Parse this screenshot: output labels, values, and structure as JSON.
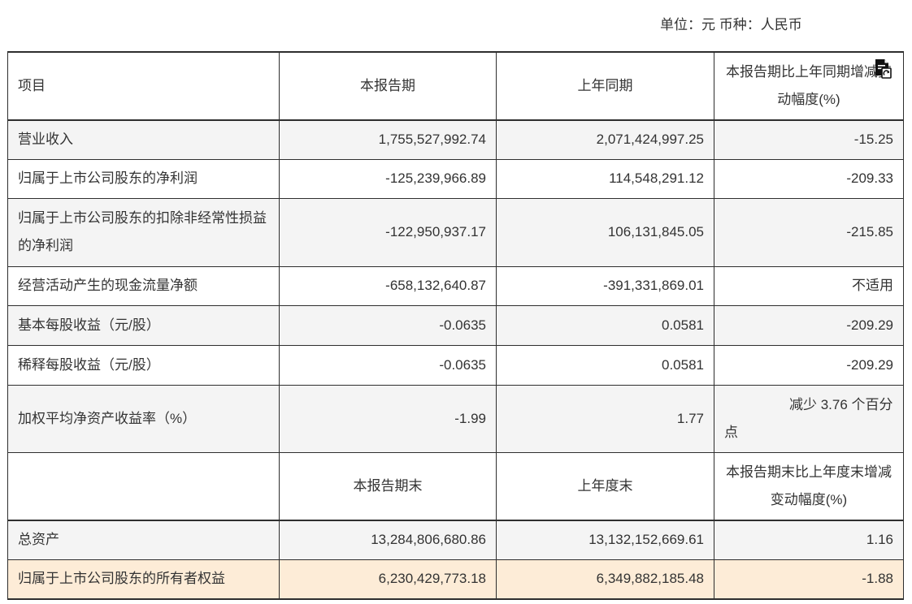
{
  "unit_note": "单位：元 币种：人民币",
  "icons": {
    "export": "document-export-icon"
  },
  "colors": {
    "row_alt": "#f4f4f4",
    "row_highlight": "#fdecd7",
    "border": "#2e2e2e",
    "text": "#333333"
  },
  "table": {
    "header": {
      "item": "项目",
      "current": "本报告期",
      "prior": "上年同期",
      "change": "本报告期比上年同期增减变动幅度(%)"
    },
    "rows": [
      {
        "item": "营业收入",
        "current": "1,755,527,992.74",
        "prior": "2,071,424,997.25",
        "change": "-15.25"
      },
      {
        "item": "归属于上市公司股东的净利润",
        "current": "-125,239,966.89",
        "prior": "114,548,291.12",
        "change": "-209.33"
      },
      {
        "item": "归属于上市公司股东的扣除非经常性损益的净利润",
        "current": "-122,950,937.17",
        "prior": "106,131,845.05",
        "change": "-215.85"
      },
      {
        "item": "经营活动产生的现金流量净额",
        "current": "-658,132,640.87",
        "prior": "-391,331,869.01",
        "change": "不适用"
      },
      {
        "item": "基本每股收益（元/股）",
        "current": "-0.0635",
        "prior": "0.0581",
        "change": "-209.29"
      },
      {
        "item": "稀释每股收益（元/股）",
        "current": "-0.0635",
        "prior": "0.0581",
        "change": "-209.29"
      },
      {
        "item": "加权平均净资产收益率（%）",
        "current": "-1.99",
        "prior": "1.77",
        "change": "减少 3.76 个百分点"
      }
    ],
    "header2": {
      "current": "本报告期末",
      "prior": "上年度末",
      "change": "本报告期末比上年度末增减变动幅度(%)"
    },
    "rows2": [
      {
        "item": "总资产",
        "current": "13,284,806,680.86",
        "prior": "13,132,152,669.61",
        "change": "1.16"
      },
      {
        "item": "归属于上市公司股东的所有者权益",
        "current": "6,230,429,773.18",
        "prior": "6,349,882,185.48",
        "change": "-1.88"
      }
    ]
  }
}
